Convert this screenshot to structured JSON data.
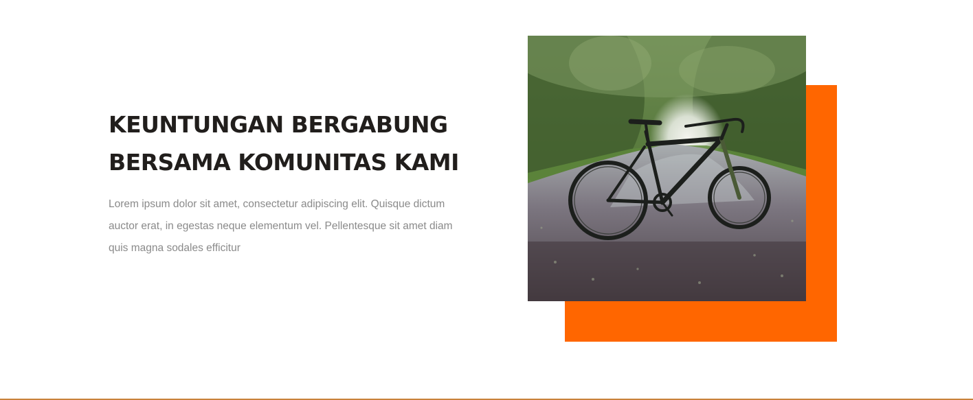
{
  "section": {
    "heading_line1": "KEUNTUNGAN BERGABUNG",
    "heading_line2": "BERSAMA KOMUNITAS KAMI",
    "body": "Lorem ipsum dolor sit amet, consectetur adipiscing elit. Quisque dictum auctor erat, in egestas neque elementum vel. Pellentesque sit amet diam quis magna sodales efficitur",
    "image_subject": "bicycle-photo"
  },
  "colors": {
    "accent": "#ff6600",
    "heading": "#211e1c",
    "body_text": "#8a8a8a",
    "rule": "#c9823a"
  }
}
